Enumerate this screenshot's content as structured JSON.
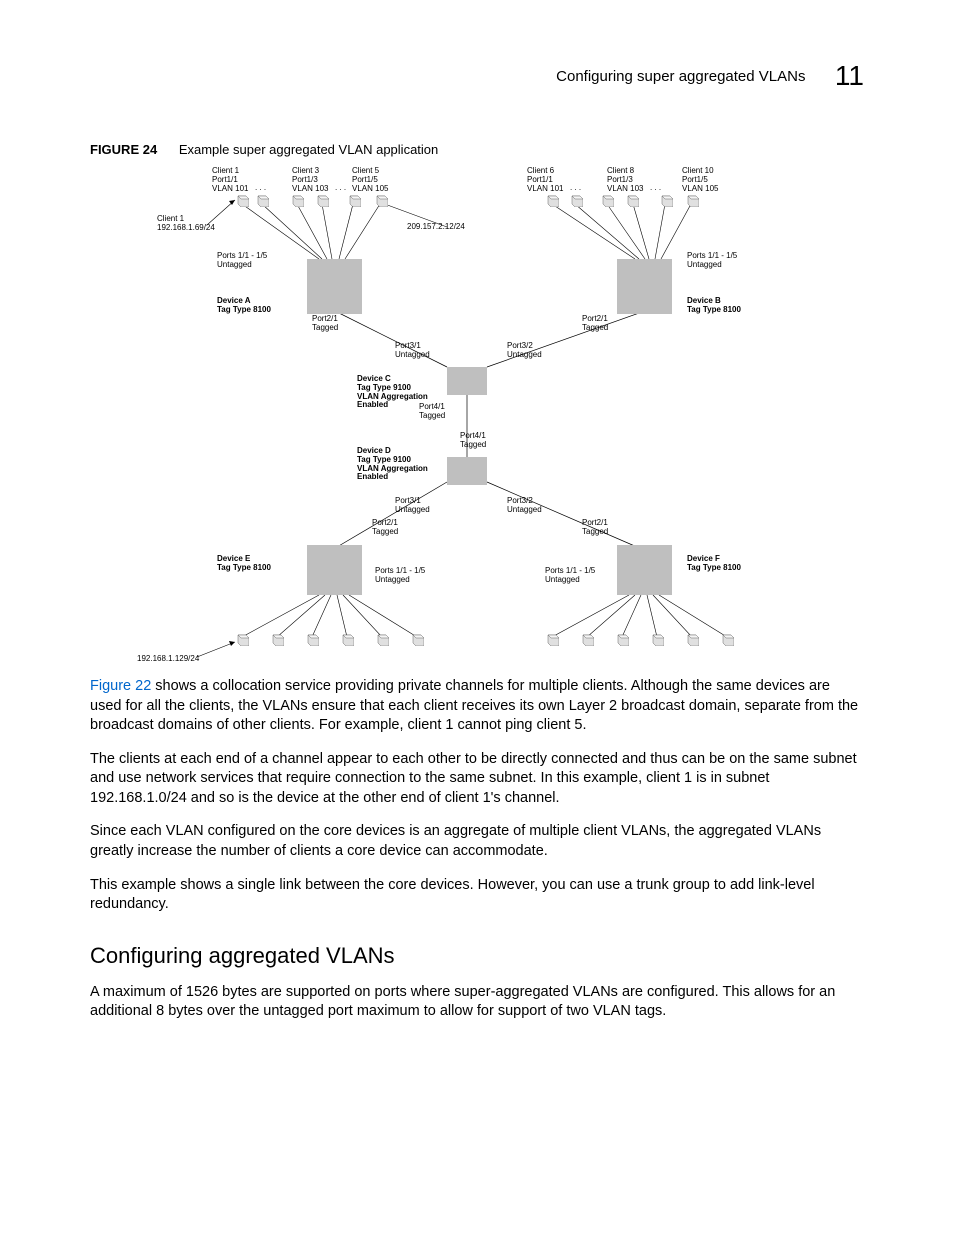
{
  "header": {
    "title": "Configuring super aggregated VLANs",
    "chapter": "11"
  },
  "figure": {
    "label": "FIGURE 24",
    "caption": "Example super aggregated VLAN application"
  },
  "diagram": {
    "top_left_clients": [
      {
        "name": "Client 1",
        "port": "Port1/1",
        "vlan": "VLAN 101"
      },
      {
        "name": "Client 3",
        "port": "Port1/3",
        "vlan": "VLAN 103"
      },
      {
        "name": "Client 5",
        "port": "Port1/5",
        "vlan": "VLAN 105"
      }
    ],
    "top_right_clients": [
      {
        "name": "Client 6",
        "port": "Port1/1",
        "vlan": "VLAN 101"
      },
      {
        "name": "Client 8",
        "port": "Port1/3",
        "vlan": "VLAN 103"
      },
      {
        "name": "Client 10",
        "port": "Port1/5",
        "vlan": "VLAN 105"
      }
    ],
    "client1_ip": "Client 1\n192.168.1.69/24",
    "ip_209": "209.157.2.12/24",
    "ports_untagged": "Ports 1/1 - 1/5\nUntagged",
    "deviceA": "Device A\nTag Type 8100",
    "deviceB": "Device B\nTag Type 8100",
    "port21_tagged": "Port2/1\nTagged",
    "port31_untagged": "Port3/1\nUntagged",
    "port32_untagged": "Port3/2\nUntagged",
    "deviceC": "Device C\nTag Type 9100\nVLAN Aggregation\nEnabled",
    "port41_tagged": "Port4/1\nTagged",
    "deviceD": "Device D\nTag Type 9100\nVLAN Aggregation\nEnabled",
    "deviceE": "Device E\nTag Type 8100",
    "deviceF": "Device F\nTag Type 8100",
    "ports_15_untagged": "Ports 1/1 - 1/5\nUntagged",
    "bottom_ip": "192.168.1.129/24",
    "dots": ". . ."
  },
  "body": {
    "p1_link": "Figure 22",
    "p1": " shows a collocation service providing private channels for multiple clients. Although the same devices are used for all the clients, the VLANs ensure that each client receives its own Layer 2 broadcast domain, separate from the broadcast domains of other clients. For example, client 1 cannot ping client 5.",
    "p2": "The clients at each end of a channel appear to each other to be directly connected and thus can be on the same subnet and use network services that require connection to the same subnet. In this example, client 1 is in subnet 192.168.1.0/24 and so is the device at the other end of client 1's channel.",
    "p3": "Since each VLAN configured on the core devices is an aggregate of multiple client VLANs, the aggregated VLANs greatly increase the number of clients a core device can accommodate.",
    "p4": "This example shows a single link between the core devices. However, you can use a trunk group to add link-level redundancy.",
    "h2": "Configuring aggregated VLANs",
    "p5": "A maximum of 1526 bytes are supported on ports where super-aggregated VLANs are configured. This allows for an additional 8 bytes over the untagged port maximum to allow for support of two VLAN tags."
  }
}
